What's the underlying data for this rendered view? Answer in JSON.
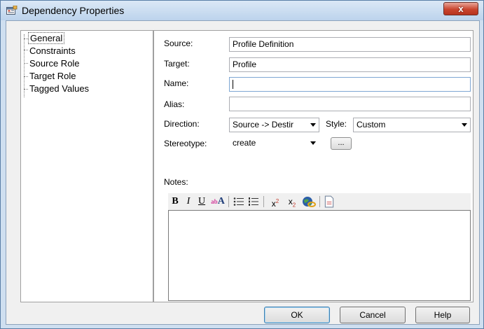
{
  "window": {
    "title": "Dependency Properties",
    "close_label": "x"
  },
  "tree": {
    "items": [
      {
        "label": "General",
        "selected": true
      },
      {
        "label": "Constraints"
      },
      {
        "label": "Source Role"
      },
      {
        "label": "Target Role"
      },
      {
        "label": "Tagged Values"
      }
    ]
  },
  "form": {
    "source_label": "Source:",
    "source_value": "Profile Definition",
    "target_label": "Target:",
    "target_value": "Profile",
    "name_label": "Name:",
    "name_value": "",
    "alias_label": "Alias:",
    "alias_value": "",
    "direction_label": "Direction:",
    "direction_value": "Source -> Destir",
    "style_label": "Style:",
    "style_value": "Custom",
    "stereotype_label": "Stereotype:",
    "stereotype_value": "create",
    "stereotype_browse": "...",
    "notes_label": "Notes:"
  },
  "toolbar": {
    "bold": "B",
    "italic": "I",
    "underline": "U",
    "color": "A"
  },
  "buttons": {
    "ok": "OK",
    "cancel": "Cancel",
    "help": "Help"
  },
  "colors": {
    "frame": "#cfdff0",
    "close": "#c9452f",
    "focus": "#7ea6d3"
  }
}
